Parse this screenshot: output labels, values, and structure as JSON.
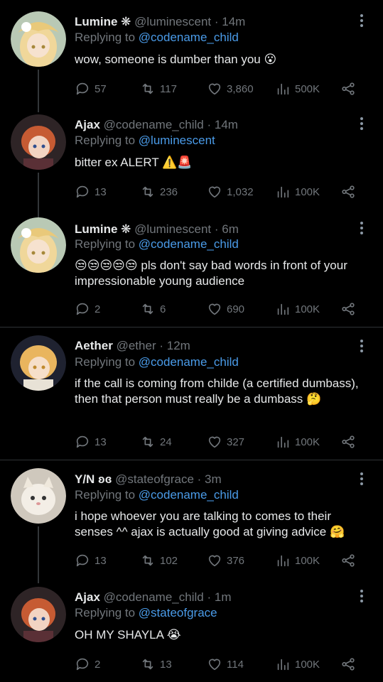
{
  "tweets": [
    {
      "name": "Lumine ❋",
      "handle": "@luminescent",
      "time": "14m",
      "replying_prefix": "Replying to ",
      "replying_to": "@codename_child",
      "text": "wow, someone is dumber than you 😮",
      "replies": "57",
      "retweets": "117",
      "likes": "3,860",
      "views": "500K",
      "avatar_colors": [
        "#c8d4c6",
        "#e9d29a"
      ]
    },
    {
      "name": "Ajax",
      "handle": "@codename_child",
      "time": "14m",
      "replying_prefix": "Replying to ",
      "replying_to": "@luminescent",
      "text": "bitter ex ALERT ⚠️🚨",
      "replies": "13",
      "retweets": "236",
      "likes": "1,032",
      "views": "100K",
      "avatar_colors": [
        "#3b2a2c",
        "#c7643a"
      ]
    },
    {
      "name": "Lumine ❋",
      "handle": "@luminescent",
      "time": "6m",
      "replying_prefix": "Replying to ",
      "replying_to": "@codename_child",
      "text_prefix": "😒😒😒😒😒",
      "text": "pls don't say bad words in front of your impressionable young audience",
      "replies": "2",
      "retweets": "6",
      "likes": "690",
      "views": "100K",
      "avatar_colors": [
        "#c8d4c6",
        "#e9d29a"
      ]
    },
    {
      "name": "Aether",
      "handle": "@ether",
      "time": "12m",
      "replying_prefix": "Replying to ",
      "replying_to": "@codename_child",
      "text": "if the call is coming from childe (a certified dumbass), then that person must really be a dumbass 🤔",
      "replies": "13",
      "retweets": "24",
      "likes": "327",
      "views": "100K",
      "avatar_colors": [
        "#2b2a3a",
        "#e3b35c"
      ]
    },
    {
      "name": "Y/N ʚɞ",
      "handle": "@stateofgrace",
      "time": "3m",
      "replying_prefix": "Replying to ",
      "replying_to": "@codename_child",
      "text": "i hope whoever you are talking to comes to their senses ^^ ajax is actually good at giving advice 🤗",
      "replies": "13",
      "retweets": "102",
      "likes": "376",
      "views": "100K",
      "avatar_colors": [
        "#d8d2c8",
        "#f4efe8"
      ]
    },
    {
      "name": "Ajax",
      "handle": "@codename_child",
      "time": "1m",
      "replying_prefix": "Replying to ",
      "replying_to": "@stateofgrace",
      "text": "OH MY SHAYLA 😭",
      "replies": "2",
      "retweets": "13",
      "likes": "114",
      "views": "100K",
      "avatar_colors": [
        "#3b2a2c",
        "#c7643a"
      ]
    }
  ]
}
